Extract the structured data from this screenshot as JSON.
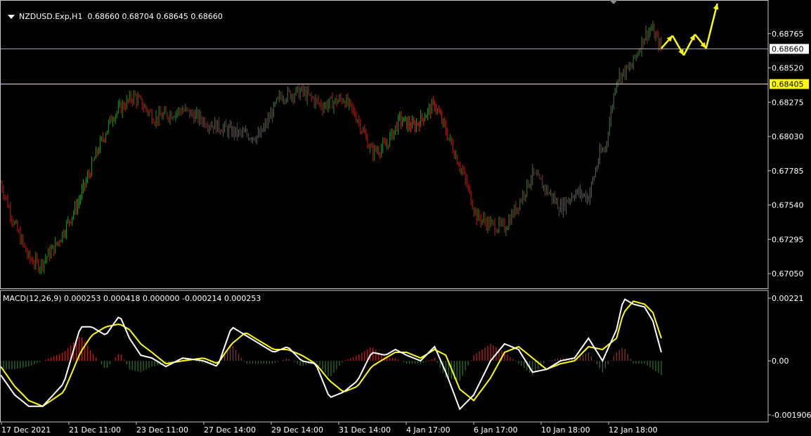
{
  "header": {
    "symbol": "NZDUSD.Exp,H1",
    "ohlc": "0.68660 0.68704 0.68645 0.68660",
    "macd": "MACD(12,26,9) 0.000253 0.000418 0.000000 -0.000214 0.000253"
  },
  "colors": {
    "background": "#000000",
    "bull": "#2e8b2e",
    "bear": "#b22222",
    "macd_line": "#ffffff",
    "signal_line": "#ffff00",
    "hist_pos": "#b22222",
    "hist_neg": "#2e6b2e",
    "bid_line": "#9aa4b0",
    "level_line": "#ffff00",
    "forecast": "#ffff00"
  },
  "chart_data": [
    {
      "type": "candlestick",
      "title": "NZDUSD.Exp,H1",
      "ylim": [
        0.6697,
        0.6898
      ],
      "price_ticks": [
        "0.68765",
        "0.68520",
        "0.68275",
        "0.68030",
        "0.67785",
        "0.67540",
        "0.67295",
        "0.67050"
      ],
      "levels": [
        {
          "label": "0.68660",
          "value": 0.6866,
          "style": "bid"
        },
        {
          "label": "0.68405",
          "value": 0.68405,
          "style": "level"
        }
      ],
      "time_labels": [
        "17 Dec 2021",
        "21 Dec 11:00",
        "23 Dec 11:00",
        "27 Dec 14:00",
        "29 Dec 14:00",
        "31 Dec 14:00",
        "4 Jan 17:00",
        "6 Jan 17:00",
        "10 Jan 18:00",
        "12 Jan 18:00"
      ],
      "path_keypoints": [
        [
          0,
          0.677
        ],
        [
          10,
          0.674
        ],
        [
          20,
          0.6716
        ],
        [
          28,
          0.6711
        ],
        [
          40,
          0.6726
        ],
        [
          55,
          0.6755
        ],
        [
          70,
          0.6795
        ],
        [
          80,
          0.6818
        ],
        [
          95,
          0.6832
        ],
        [
          110,
          0.6816
        ],
        [
          130,
          0.6822
        ],
        [
          150,
          0.6812
        ],
        [
          170,
          0.6805
        ],
        [
          185,
          0.6803
        ],
        [
          200,
          0.6832
        ],
        [
          215,
          0.6835
        ],
        [
          230,
          0.6825
        ],
        [
          245,
          0.683
        ],
        [
          255,
          0.6816
        ],
        [
          265,
          0.6792
        ],
        [
          275,
          0.6796
        ],
        [
          285,
          0.6815
        ],
        [
          295,
          0.681
        ],
        [
          310,
          0.6826
        ],
        [
          320,
          0.6802
        ],
        [
          330,
          0.6777
        ],
        [
          340,
          0.6746
        ],
        [
          350,
          0.674
        ],
        [
          360,
          0.6738
        ],
        [
          370,
          0.6755
        ],
        [
          380,
          0.6776
        ],
        [
          390,
          0.6765
        ],
        [
          400,
          0.6752
        ],
        [
          410,
          0.6763
        ],
        [
          420,
          0.676
        ],
        [
          428,
          0.679
        ],
        [
          432,
          0.6795
        ],
        [
          440,
          0.6845
        ],
        [
          450,
          0.6852
        ],
        [
          460,
          0.6875
        ],
        [
          465,
          0.688
        ],
        [
          472,
          0.6866
        ]
      ],
      "forecast": [
        [
          472,
          0.6866
        ],
        [
          480,
          0.6875
        ],
        [
          488,
          0.6861
        ],
        [
          496,
          0.6876
        ],
        [
          504,
          0.6866
        ],
        [
          512,
          0.6898
        ]
      ]
    },
    {
      "type": "line",
      "title": "MACD(12,26,9)",
      "ylim": [
        -0.001906,
        0.00221
      ],
      "ticks": [
        "0.00221",
        "0.00",
        "-0.001906"
      ],
      "series": [
        {
          "name": "MACD",
          "x": [
            0,
            10,
            20,
            30,
            45,
            57,
            65,
            75,
            85,
            92,
            100,
            108,
            118,
            130,
            145,
            155,
            165,
            175,
            185,
            195,
            205,
            215,
            225,
            235,
            245,
            255,
            265,
            275,
            282,
            290,
            300,
            310,
            318,
            328,
            338,
            350,
            360,
            370,
            380,
            390,
            400,
            410,
            420,
            430,
            440,
            445,
            452,
            460,
            466,
            472
          ],
          "values": [
            -0.0005,
            -0.0012,
            -0.0016,
            -0.0016,
            -0.0008,
            0.0012,
            0.0012,
            0.0009,
            0.0016,
            0.0008,
            0.0002,
            0.0001,
            -0.0002,
            0.0001,
            0.0,
            -0.0002,
            0.0012,
            0.0009,
            0.0006,
            0.0003,
            0.0005,
            0.0,
            -0.0001,
            -0.0013,
            -0.0011,
            -0.0007,
            0.0003,
            0.0002,
            0.0004,
            0.0002,
            0.0,
            0.0005,
            -0.0004,
            -0.0017,
            -0.0012,
            0.0,
            0.0006,
            0.0004,
            -0.0004,
            -0.0003,
            0.0,
            0.0001,
            0.0008,
            0.0,
            0.0011,
            0.0022,
            0.002,
            0.0019,
            0.0014,
            0.0003
          ]
        },
        {
          "name": "Signal",
          "x": [
            0,
            10,
            20,
            30,
            45,
            57,
            65,
            75,
            85,
            92,
            100,
            108,
            118,
            130,
            145,
            155,
            165,
            175,
            185,
            195,
            205,
            215,
            225,
            235,
            245,
            255,
            265,
            275,
            282,
            290,
            300,
            310,
            318,
            328,
            338,
            350,
            360,
            370,
            380,
            390,
            400,
            410,
            420,
            430,
            440,
            445,
            452,
            460,
            466,
            472
          ],
          "values": [
            -0.0002,
            -0.0009,
            -0.0014,
            -0.0016,
            -0.0011,
            0.0003,
            0.0009,
            0.0012,
            0.0013,
            0.0011,
            0.0006,
            0.0003,
            -0.0001,
            0.0,
            0.0001,
            -0.0001,
            0.0006,
            0.001,
            0.0007,
            0.0004,
            0.0004,
            0.0002,
            -0.0001,
            -0.0007,
            -0.0011,
            -0.0009,
            -0.0002,
            0.0001,
            0.0003,
            0.0003,
            0.0001,
            0.0004,
            0.0002,
            -0.001,
            -0.0014,
            -0.0006,
            0.0003,
            0.0005,
            0.0001,
            -0.0003,
            -0.0001,
            0.0,
            0.0005,
            0.0004,
            0.0008,
            0.0017,
            0.0021,
            0.002,
            0.0017,
            0.0008
          ]
        }
      ]
    }
  ]
}
